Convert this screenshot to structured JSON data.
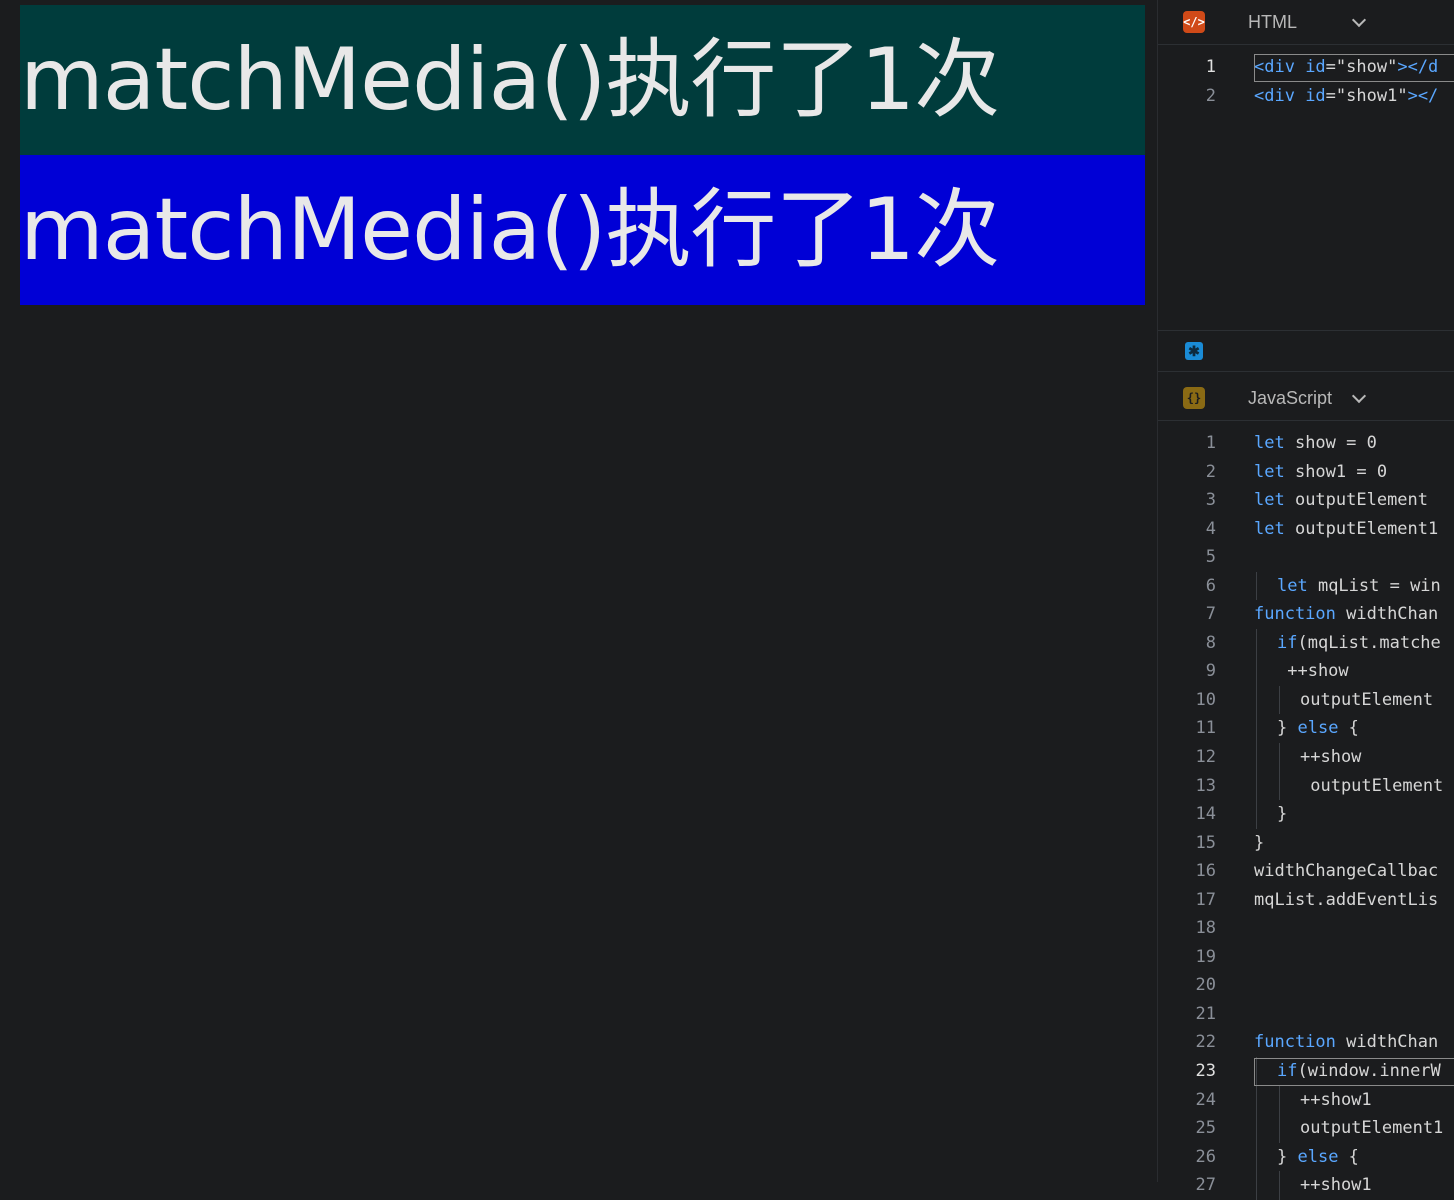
{
  "preview": {
    "show_text": "matchMedia()执行了1次",
    "show1_text": "matchMedia()执行了1次",
    "colors": {
      "show_bg": "#003c3c",
      "show1_bg": "#0000d6",
      "text": "#e8e8e8"
    }
  },
  "html_panel": {
    "icon": "html-icon",
    "language": "HTML",
    "lines": [
      {
        "num": "1",
        "segments": [
          [
            "tag",
            "<div "
          ],
          [
            "attr",
            "id"
          ],
          [
            "txt",
            "="
          ],
          [
            "str",
            "\"show\""
          ],
          [
            "tag",
            "></d"
          ]
        ]
      },
      {
        "num": "2",
        "segments": [
          [
            "tag",
            "<div "
          ],
          [
            "attr",
            "id"
          ],
          [
            "txt",
            "="
          ],
          [
            "str",
            "\"show1\""
          ],
          [
            "tag",
            "></"
          ]
        ]
      }
    ]
  },
  "css_panel": {
    "icon": "css-asterisk-icon"
  },
  "js_panel": {
    "icon": "js-braces-icon",
    "language": "JavaScript",
    "lines": [
      {
        "num": "1",
        "indent": 0,
        "segments": [
          [
            "kw",
            "let"
          ],
          [
            "txt",
            " show = 0"
          ]
        ]
      },
      {
        "num": "2",
        "indent": 0,
        "segments": [
          [
            "kw",
            "let"
          ],
          [
            "txt",
            " show1 = 0"
          ]
        ]
      },
      {
        "num": "3",
        "indent": 0,
        "segments": [
          [
            "kw",
            "let"
          ],
          [
            "txt",
            " outputElement"
          ]
        ]
      },
      {
        "num": "4",
        "indent": 0,
        "segments": [
          [
            "kw",
            "let"
          ],
          [
            "txt",
            " outputElement1"
          ]
        ]
      },
      {
        "num": "5",
        "indent": 0,
        "segments": []
      },
      {
        "num": "6",
        "indent": 1,
        "segments": [
          [
            "kw",
            "let"
          ],
          [
            "txt",
            " mqList = win"
          ]
        ]
      },
      {
        "num": "7",
        "indent": 0,
        "segments": [
          [
            "kw",
            "function"
          ],
          [
            "txt",
            " widthChan"
          ]
        ]
      },
      {
        "num": "8",
        "indent": 1,
        "segments": [
          [
            "kw",
            "if"
          ],
          [
            "txt",
            "(mqList.matche"
          ]
        ]
      },
      {
        "num": "9",
        "indent": 1,
        "segments": [
          [
            "txt",
            " ++show"
          ]
        ]
      },
      {
        "num": "10",
        "indent": 2,
        "segments": [
          [
            "txt",
            "outputElement"
          ]
        ]
      },
      {
        "num": "11",
        "indent": 1,
        "segments": [
          [
            "txt",
            "} "
          ],
          [
            "kw",
            "else"
          ],
          [
            "txt",
            " {"
          ]
        ]
      },
      {
        "num": "12",
        "indent": 2,
        "segments": [
          [
            "txt",
            "++show"
          ]
        ]
      },
      {
        "num": "13",
        "indent": 2,
        "segments": [
          [
            "txt",
            " outputElement"
          ]
        ]
      },
      {
        "num": "14",
        "indent": 1,
        "segments": [
          [
            "txt",
            "}"
          ]
        ]
      },
      {
        "num": "15",
        "indent": 0,
        "segments": [
          [
            "txt",
            "}"
          ]
        ]
      },
      {
        "num": "16",
        "indent": 0,
        "segments": [
          [
            "txt",
            "widthChangeCallbac"
          ]
        ]
      },
      {
        "num": "17",
        "indent": 0,
        "segments": [
          [
            "txt",
            "mqList.addEventLis"
          ]
        ]
      },
      {
        "num": "18",
        "indent": 0,
        "segments": []
      },
      {
        "num": "19",
        "indent": 0,
        "segments": []
      },
      {
        "num": "20",
        "indent": 0,
        "segments": []
      },
      {
        "num": "21",
        "indent": 0,
        "segments": []
      },
      {
        "num": "22",
        "indent": 0,
        "segments": [
          [
            "kw",
            "function"
          ],
          [
            "txt",
            " widthChan"
          ]
        ]
      },
      {
        "num": "23",
        "indent": 1,
        "segments": [
          [
            "kw",
            "if"
          ],
          [
            "txt",
            "(window.innerW"
          ]
        ]
      },
      {
        "num": "24",
        "indent": 2,
        "segments": [
          [
            "txt",
            "++show1"
          ]
        ]
      },
      {
        "num": "25",
        "indent": 2,
        "segments": [
          [
            "txt",
            "outputElement1"
          ]
        ]
      },
      {
        "num": "26",
        "indent": 1,
        "segments": [
          [
            "txt",
            "} "
          ],
          [
            "kw",
            "else"
          ],
          [
            "txt",
            " {"
          ]
        ]
      },
      {
        "num": "27",
        "indent": 2,
        "segments": [
          [
            "txt",
            "++show1"
          ]
        ]
      }
    ]
  }
}
